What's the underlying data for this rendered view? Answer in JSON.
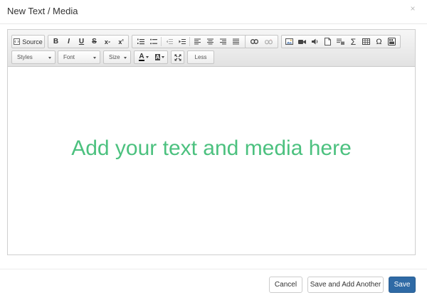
{
  "modal": {
    "title": "New Text / Media",
    "close_glyph": "×"
  },
  "toolbar": {
    "source_label": "Source",
    "bold": "B",
    "italic": "I",
    "underline": "U",
    "strike": "S",
    "subscript": "x",
    "subscript_mark": "₂",
    "superscript": "x",
    "superscript_mark": "²",
    "styles_label": "Styles",
    "font_label": "Font",
    "size_label": "Size",
    "text_color_glyph": "A",
    "bg_color_glyph": "A",
    "less_label": "Less",
    "omega_glyph": "Ω",
    "sigma_glyph": "Σ"
  },
  "editor": {
    "placeholder": "Add your text and media here",
    "placeholder_color": "#4cc17f"
  },
  "footer": {
    "cancel_label": "Cancel",
    "save_another_label": "Save and Add Another",
    "save_label": "Save",
    "primary_color": "#2f6aa5"
  }
}
